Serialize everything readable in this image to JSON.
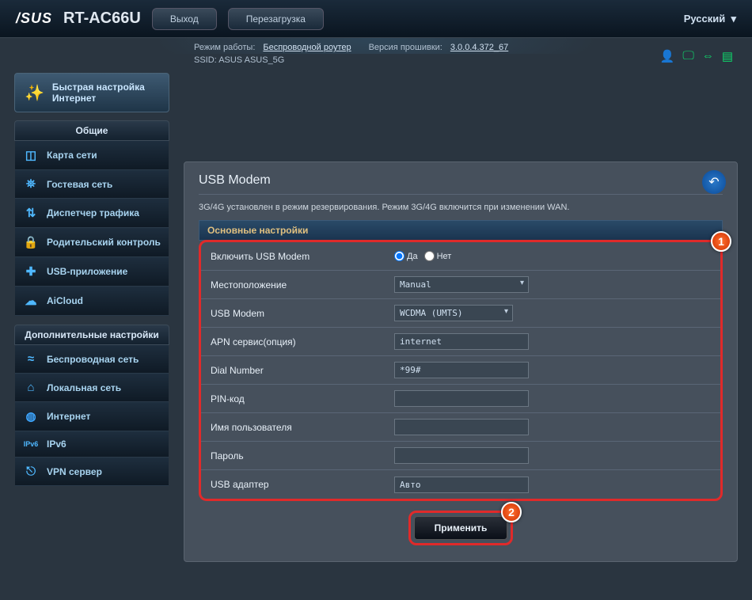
{
  "top": {
    "brand": "/SUS",
    "model": "RT-AC66U",
    "logout": "Выход",
    "reboot": "Перезагрузка",
    "language": "Русский"
  },
  "info": {
    "mode_label": "Режим работы:",
    "mode_value": "Беспроводной роутер",
    "fw_label": "Версия прошивки:",
    "fw_value": "3.0.0.4.372_67",
    "ssid_label": "SSID:",
    "ssid1": "ASUS",
    "ssid2": "ASUS_5G"
  },
  "qis": "Быстрая настройка Интернет",
  "general_header": "Общие",
  "general": [
    {
      "icon": "◫",
      "label": "Карта сети"
    },
    {
      "icon": "⛯",
      "label": "Гостевая сеть"
    },
    {
      "icon": "⇅",
      "label": "Диспетчер трафика"
    },
    {
      "icon": "🔒",
      "label": "Родительский контроль"
    },
    {
      "icon": "✚",
      "label": "USB-приложение"
    },
    {
      "icon": "☁",
      "label": "AiCloud"
    }
  ],
  "advanced_header": "Дополнительные настройки",
  "advanced": [
    {
      "icon": "≈",
      "label": "Беспроводная сеть"
    },
    {
      "icon": "⌂",
      "label": "Локальная сеть"
    },
    {
      "icon": "◍",
      "label": "Интернет"
    },
    {
      "icon": "IPv6",
      "label": "IPv6"
    },
    {
      "icon": "⎋",
      "label": "VPN сервер"
    }
  ],
  "panel": {
    "title": "USB Modem",
    "desc": "3G/4G установлен в режим резервирования. Режим 3G/4G включится при изменении WAN.",
    "section": "Основные настройки",
    "rows": {
      "enable_label": "Включить USB Modem",
      "yes": "Да",
      "no": "Нет",
      "location_label": "Местоположение",
      "location_value": "Manual",
      "modem_label": "USB Modem",
      "modem_value": "WCDMA (UMTS)",
      "apn_label": "APN сервис(опция)",
      "apn_value": "internet",
      "dial_label": "Dial Number",
      "dial_value": "*99#",
      "pin_label": "PIN-код",
      "pin_value": "",
      "user_label": "Имя пользователя",
      "user_value": "",
      "pass_label": "Пароль",
      "pass_value": "",
      "adapter_label": "USB адаптер",
      "adapter_value": "Авто"
    },
    "apply": "Применить"
  },
  "badges": {
    "one": "1",
    "two": "2"
  }
}
